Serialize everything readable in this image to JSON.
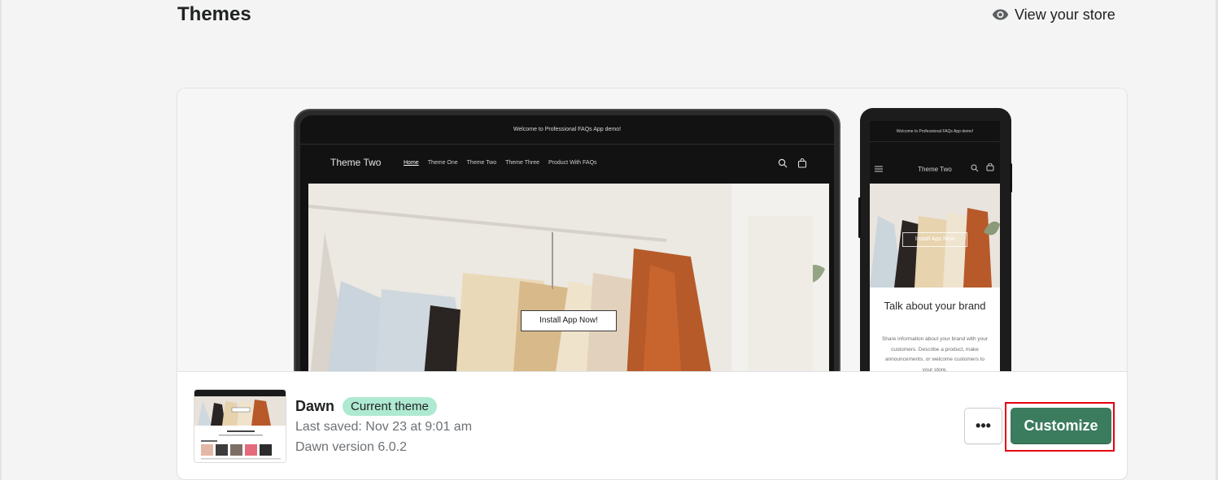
{
  "page": {
    "title": "Themes",
    "view_store_label": "View your store"
  },
  "preview": {
    "desktop": {
      "announcement": "Welcome to Professional FAQs App demo!",
      "store_name": "Theme Two",
      "nav": [
        {
          "label": "Home",
          "active": true
        },
        {
          "label": "Theme One"
        },
        {
          "label": "Theme Two"
        },
        {
          "label": "Theme Three"
        },
        {
          "label": "Product With FAQs"
        }
      ],
      "hero_button": "Install App Now!"
    },
    "mobile": {
      "announcement": "Welcome to Professional FAQs App demo!",
      "store_name": "Theme Two",
      "hero_button": "Install App Now",
      "heading": "Talk about your brand",
      "text": "Share information about your brand with your customers. Describe a product, make announcements, or welcome customers to your store."
    }
  },
  "theme": {
    "name": "Dawn",
    "badge": "Current theme",
    "last_saved": "Last saved: Nov 23 at 9:01 am",
    "version": "Dawn version 6.0.2"
  },
  "actions": {
    "more_label": "•••",
    "customize_label": "Customize"
  },
  "colors": {
    "accent": "#3b7c5e",
    "badge_bg": "#aee9d1",
    "highlight": "#e60012"
  }
}
